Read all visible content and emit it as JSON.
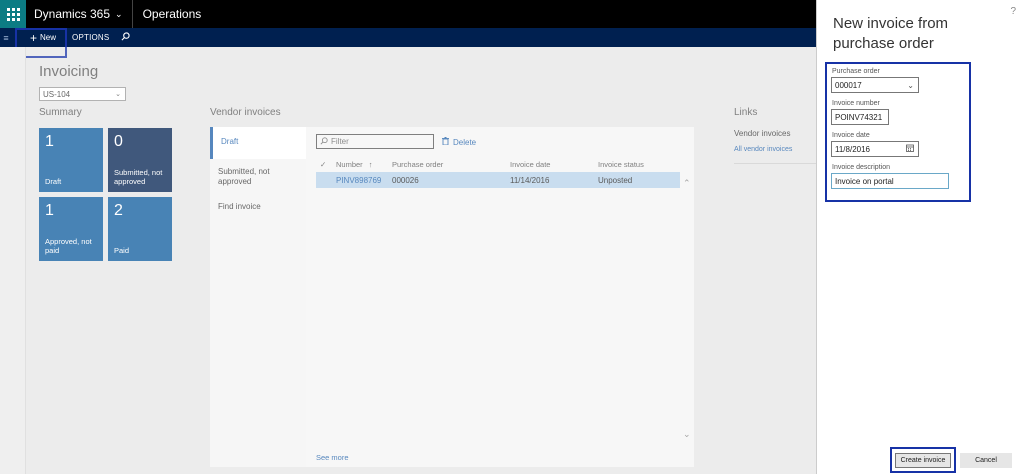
{
  "app": {
    "brand": "Dynamics 365",
    "module": "Operations"
  },
  "actionbar": {
    "new_label": "New",
    "options_label": "OPTIONS"
  },
  "page": {
    "title": "Invoicing",
    "company": "US-104"
  },
  "summary": {
    "title": "Summary",
    "tiles": [
      {
        "count": "1",
        "label": "Draft"
      },
      {
        "count": "0",
        "label": "Submitted, not approved"
      },
      {
        "count": "1",
        "label": "Approved, not paid"
      },
      {
        "count": "2",
        "label": "Paid"
      }
    ]
  },
  "vendor_invoices": {
    "title": "Vendor invoices",
    "tabs": [
      "Draft",
      "Submitted, not approved",
      "Find invoice"
    ],
    "filter_placeholder": "Filter",
    "delete_label": "Delete",
    "columns": [
      "Number",
      "Purchase order",
      "Invoice date",
      "Invoice status"
    ],
    "sort_indicator": "↑",
    "rows": [
      {
        "number": "PINV898769",
        "purchase_order": "000026",
        "invoice_date": "11/14/2016",
        "status": "Unposted"
      }
    ],
    "see_more": "See more"
  },
  "links": {
    "title": "Links",
    "subtitle": "Vendor invoices",
    "items": [
      "All vendor invoices"
    ]
  },
  "dialog": {
    "title": "New invoice from purchase order",
    "help": "?",
    "fields": {
      "purchase_order_label": "Purchase order",
      "purchase_order_value": "000017",
      "invoice_number_label": "Invoice number",
      "invoice_number_value": "POINV74321",
      "invoice_date_label": "Invoice date",
      "invoice_date_value": "11/8/2016",
      "invoice_description_label": "Invoice description",
      "invoice_description_value": "Invoice on portal"
    },
    "create_label": "Create invoice",
    "cancel_label": "Cancel"
  },
  "colors": {
    "nav_black": "#000000",
    "waffle_teal": "#0c7c84",
    "actionbar_navy": "#002050",
    "tile_blue": "#0b5a9c",
    "tile_dark": "#002050",
    "highlight": "#1732a6",
    "selected_row": "#b7d2ea",
    "link": "#1e5fa8"
  },
  "icons": [
    "waffle-icon",
    "chevron-down-icon",
    "hamburger-icon",
    "plus-icon",
    "search-icon",
    "filter-icon",
    "delete-icon",
    "check-icon",
    "sort-up-icon",
    "calendar-icon",
    "help-icon"
  ]
}
